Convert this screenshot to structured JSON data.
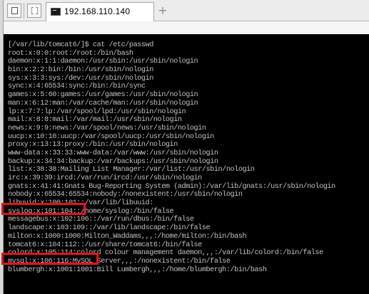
{
  "tab": {
    "title": "192.168.110.140",
    "add_label": "+"
  },
  "terminal": {
    "lines": [
      "[/var/lib/tomcat6/]$ cat /etc/passwd",
      "root:x:0:0:root:/root:/bin/bash",
      "daemon:x:1:1:daemon:/usr/sbin:/usr/sbin/nologin",
      "bin:x:2:2:bin:/bin:/usr/sbin/nologin",
      "sys:x:3:3:sys:/dev:/usr/sbin/nologin",
      "sync:x:4:65534:sync:/bin:/bin/sync",
      "games:x:5:60:games:/usr/games:/usr/sbin/nologin",
      "man:x:6:12:man:/var/cache/man:/usr/sbin/nologin",
      "lp:x:7:7:lp:/var/spool/lpd:/usr/sbin/nologin",
      "mail:x:8:8:mail:/var/mail:/usr/sbin/nologin",
      "news:x:9:9:news:/var/spool/news:/usr/sbin/nologin",
      "uucp:x:10:10:uucp:/var/spool/uucp:/usr/sbin/nologin",
      "proxy:x:13:13:proxy:/bin:/usr/sbin/nologin",
      "www-data:x:33:33:www-data:/var/www:/usr/sbin/nologin",
      "backup:x:34:34:backup:/var/backups:/usr/sbin/nologin",
      "list:x:38:38:Mailing List Manager:/var/list:/usr/sbin/nologin",
      "irc:x:39:39:ircd:/var/run/ircd:/usr/sbin/nologin",
      "gnats:x:41:41:Gnats Bug-Reporting System (admin):/var/lib/gnats:/usr/sbin/nologin",
      "nobody:x:65534:65534:nobody:/nonexistent:/usr/sbin/nologin",
      "libuuid:x:100:101::/var/lib/libuuid:",
      "syslog:x:101:104::/home/syslog:/bin/false",
      "messagebus:x:102:106::/var/run/dbus:/bin/false",
      "landscape:x:103:109::/var/lib/landscape:/bin/false",
      "milton:x:1000:1000:Milton_Waddams,,,:/home/milton:/bin/bash",
      "tomcat6:x:104:112::/usr/share/tomcat6:/bin/false",
      "colord:x:105:114:colord colour management daemon,,,:/var/lib/colord:/bin/false",
      "mysql:x:106:116:MySQL Server,,,:/nonexistent:/bin/false",
      "blumbergh:x:1001:1001:Bill Lumbergh,,,:/home/blumbergh:/bin/bash"
    ]
  },
  "colors": {
    "terminal_bg": "#000000",
    "terminal_text": "#c2c2c2",
    "highlight": "#e3141b"
  },
  "icons": {
    "sidebar_toggle": "panel-icon",
    "new_window": "window-icon",
    "terminal": "terminal-icon"
  }
}
